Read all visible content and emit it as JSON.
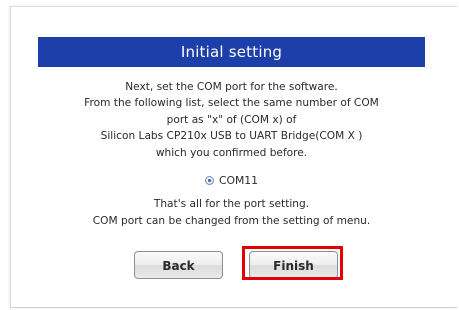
{
  "dialog": {
    "title": "Initial setting",
    "instructions": [
      "Next, set the COM port for the software.",
      "From the following list, select the same number of COM",
      "port as \"x\" of (COM x) of",
      "Silicon Labs CP210x USB to UART Bridge(COM X )",
      "which you confirmed before."
    ],
    "port_option": {
      "label": "COM11",
      "selected": true
    },
    "completion": [
      "That's all for the port setting.",
      "COM port can be changed from the setting of menu."
    ],
    "buttons": {
      "back": "Back",
      "finish": "Finish"
    }
  },
  "colors": {
    "header_bg": "#1c3faa",
    "header_text": "#ffffff",
    "highlight": "#e30000"
  }
}
